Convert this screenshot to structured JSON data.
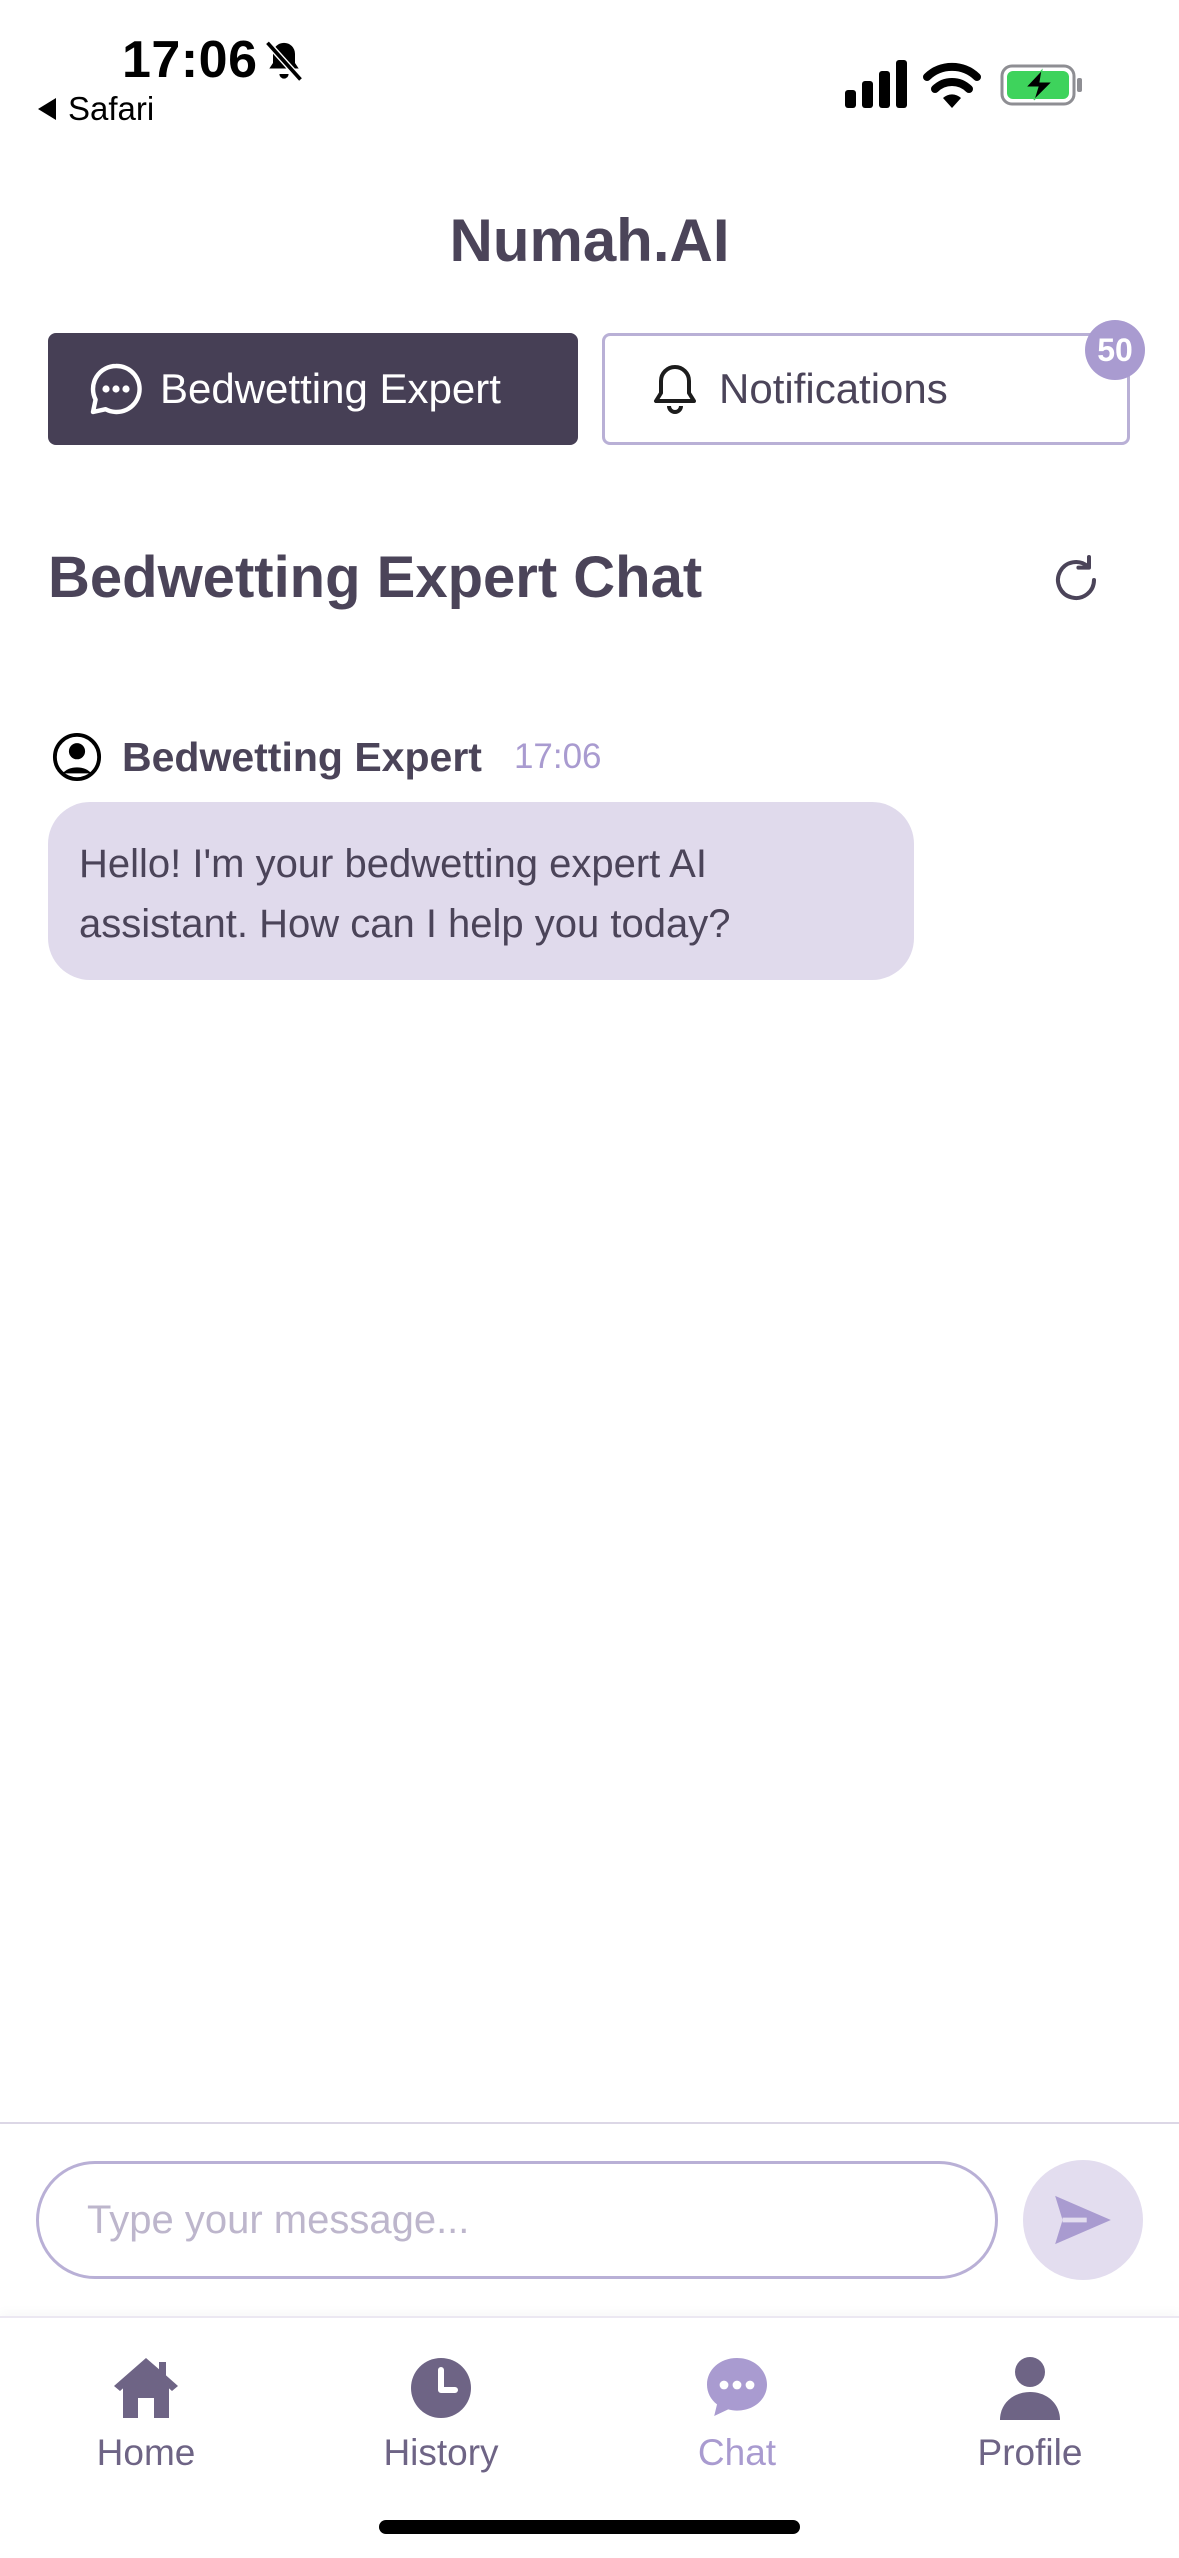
{
  "status_bar": {
    "time": "17:06",
    "back_app": "Safari",
    "icons": [
      "bell-slash-icon",
      "cellular-signal-icon",
      "wifi-icon",
      "battery-charging-icon"
    ]
  },
  "header": {
    "title": "Numah.AI"
  },
  "tabs": {
    "expert_label": "Bedwetting Expert",
    "notifications_label": "Notifications",
    "notifications_badge": "50"
  },
  "chat": {
    "title": "Bedwetting Expert Chat",
    "messages": [
      {
        "sender": "Bedwetting Expert",
        "time": "17:06",
        "text": "Hello! I'm your bedwetting expert AI assistant. How can I help you today?"
      }
    ]
  },
  "composer": {
    "placeholder": "Type your message..."
  },
  "bottom_nav": {
    "items": [
      {
        "label": "Home",
        "icon": "home-icon"
      },
      {
        "label": "History",
        "icon": "clock-icon"
      },
      {
        "label": "Chat",
        "icon": "chat-bubble-icon",
        "active": true
      },
      {
        "label": "Profile",
        "icon": "person-icon"
      }
    ]
  },
  "colors": {
    "primary_dark": "#463f55",
    "accent": "#a99bd0",
    "bubble": "#e0daec",
    "text": "#4b4459"
  }
}
